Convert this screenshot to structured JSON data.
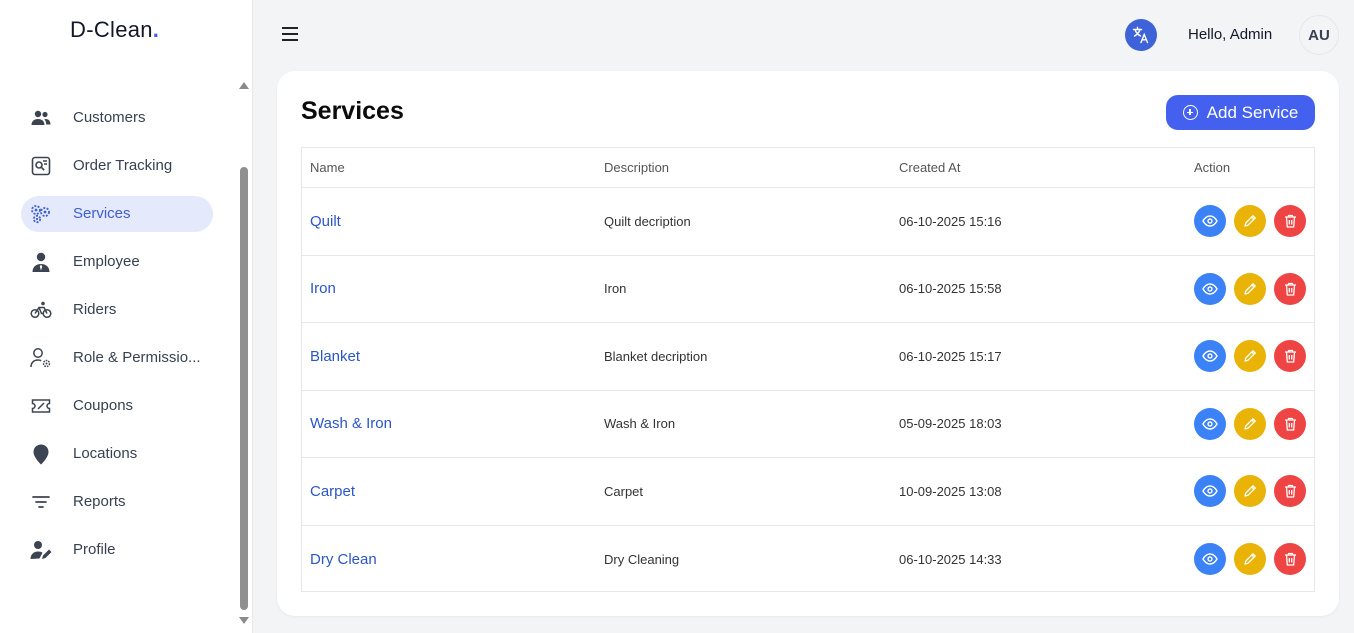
{
  "brand": {
    "name": "D-Clean",
    "dot": "."
  },
  "sidebar": {
    "items": [
      {
        "label": "Customers",
        "icon": "users-icon",
        "active": false
      },
      {
        "label": "Order Tracking",
        "icon": "order-tracking-icon",
        "active": false
      },
      {
        "label": "Services",
        "icon": "gears-icon",
        "active": true
      },
      {
        "label": "Employee",
        "icon": "employee-icon",
        "active": false
      },
      {
        "label": "Riders",
        "icon": "bicycle-icon",
        "active": false
      },
      {
        "label": "Role & Permissio...",
        "icon": "user-cog-icon",
        "active": false
      },
      {
        "label": "Coupons",
        "icon": "coupon-icon",
        "active": false
      },
      {
        "label": "Locations",
        "icon": "map-pin-icon",
        "active": false
      },
      {
        "label": "Reports",
        "icon": "filter-lines-icon",
        "active": false
      },
      {
        "label": "Profile",
        "icon": "user-edit-icon",
        "active": false
      }
    ]
  },
  "header": {
    "greeting": "Hello, Admin",
    "avatar_initials": "AU"
  },
  "page": {
    "title": "Services",
    "add_button": "Add Service",
    "columns": [
      "Name",
      "Description",
      "Created At",
      "Action"
    ],
    "rows": [
      {
        "name": "Quilt",
        "description": "Quilt decription",
        "created_at": "06-10-2025 15:16"
      },
      {
        "name": "Iron",
        "description": "Iron",
        "created_at": "06-10-2025 15:58"
      },
      {
        "name": "Blanket",
        "description": "Blanket decription",
        "created_at": "06-10-2025 15:17"
      },
      {
        "name": "Wash & Iron",
        "description": "Wash & Iron",
        "created_at": "05-09-2025 18:03"
      },
      {
        "name": "Carpet",
        "description": "Carpet",
        "created_at": "10-09-2025 13:08"
      },
      {
        "name": "Dry Clean",
        "description": "Dry Cleaning",
        "created_at": "06-10-2025 14:33"
      }
    ]
  },
  "colors": {
    "primary": "#4361ee",
    "view": "#3b82f6",
    "edit": "#eab308",
    "delete": "#ef4444",
    "active_bg": "#e4e9fb"
  }
}
